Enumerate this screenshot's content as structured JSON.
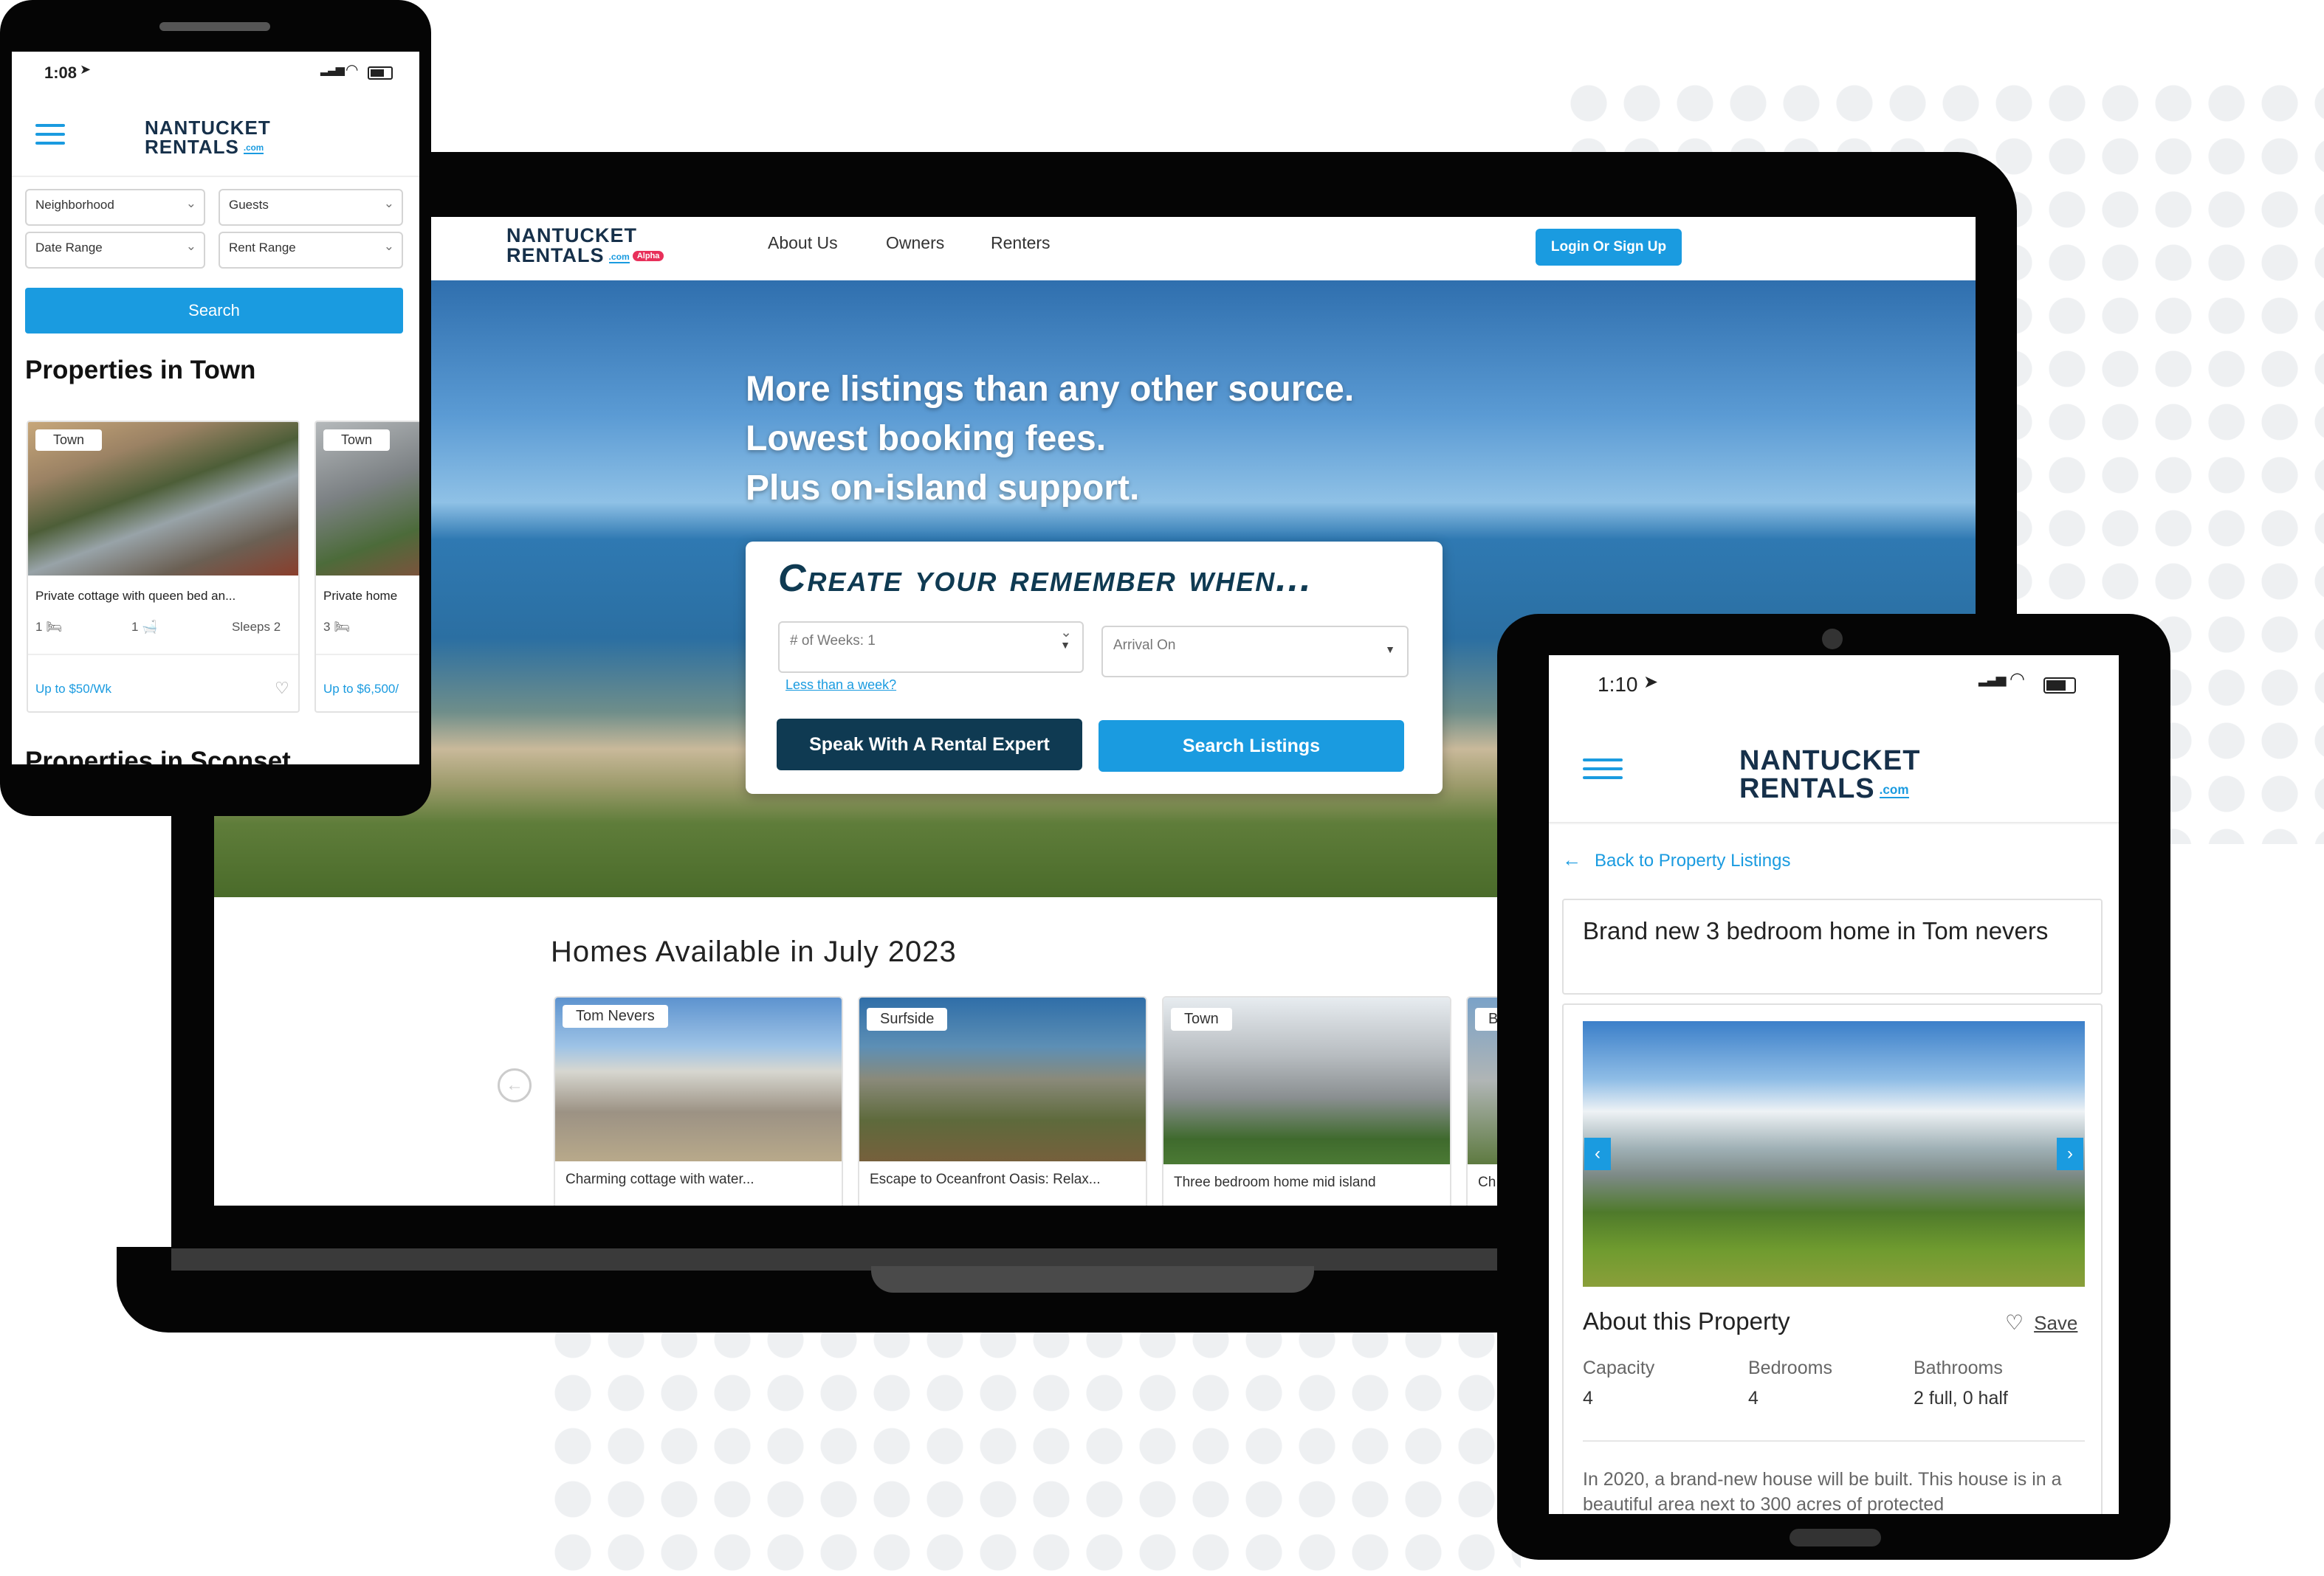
{
  "brand": {
    "line1": "NANTUCKET",
    "line2": "RENTALS",
    "com": ".com",
    "alpha_badge": "Alpha",
    "accent": "#1a9be0",
    "navy": "#0f3a52"
  },
  "laptop": {
    "nav": [
      "About Us",
      "Owners",
      "Renters"
    ],
    "login_label": "Login Or Sign Up",
    "hero": {
      "line1": "More listings than any other source.",
      "line2": "Lowest booking fees.",
      "line3": "Plus on-island support."
    },
    "search_box": {
      "title": "Create your remember when...",
      "weeks_value": "# of Weeks: 1",
      "arrival_placeholder": "Arrival On",
      "less_link": "Less than a week?",
      "expert_button": "Speak With A Rental Expert",
      "search_button": "Search Listings"
    },
    "homes": {
      "heading": "Homes Available in July 2023",
      "cards": [
        {
          "tag": "Tom Nevers",
          "title": "Charming cottage with water..."
        },
        {
          "tag": "Surfside",
          "title": "Escape to Oceanfront Oasis: Relax..."
        },
        {
          "tag": "Town",
          "title": "Three bedroom home mid island"
        },
        {
          "tag": "B",
          "title": "Ch"
        }
      ]
    }
  },
  "phone": {
    "time": "1:08",
    "filters": {
      "neighborhood": "Neighborhood",
      "guests": "Guests",
      "date_range": "Date Range",
      "rent_range": "Rent Range"
    },
    "search_label": "Search",
    "section_title": "Properties in Town",
    "next_section_title": "Properties in Sconset",
    "cards": [
      {
        "tag": "Town",
        "title": "Private cottage with queen bed an...",
        "beds": "1",
        "baths": "1",
        "sleeps": "Sleeps 2",
        "price": "Up to $50/Wk"
      },
      {
        "tag": "Town",
        "title": "Private home",
        "beds": "3",
        "price": "Up to $6,500/"
      }
    ]
  },
  "tablet": {
    "time": "1:10",
    "back_link": "Back to Property Listings",
    "title": "Brand new 3 bedroom home in Tom nevers",
    "about_title": "About this Property",
    "save_label": "Save",
    "stats": [
      {
        "label": "Capacity",
        "value": "4"
      },
      {
        "label": "Bedrooms",
        "value": "4"
      },
      {
        "label": "Bathrooms",
        "value": "2 full, 0 half"
      }
    ],
    "description": "In 2020, a brand-new house will be built. This house is in a beautiful area next to 300 acres of protected"
  },
  "icons": {
    "menu": "hamburger-menu-icon",
    "heart": "heart-icon",
    "back": "arrow-left-icon",
    "bed": "bed-icon",
    "bath": "bath-icon",
    "wifi": "wifi-icon",
    "battery": "battery-icon",
    "signal": "signal-icon",
    "location": "location-arrow-icon",
    "prev": "chevron-left-icon",
    "next": "chevron-right-icon",
    "dropdown": "caret-down-icon"
  }
}
